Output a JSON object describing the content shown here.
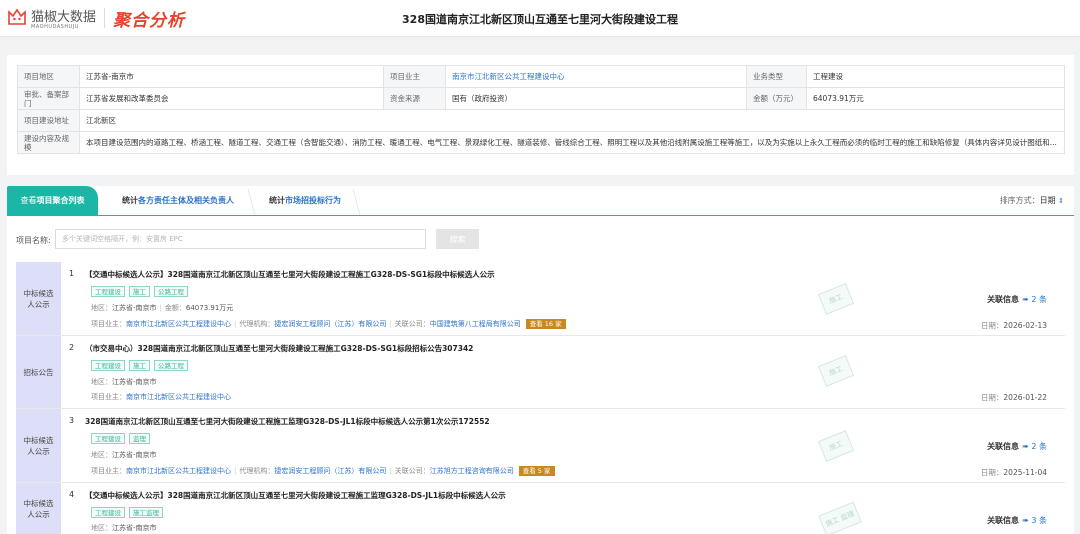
{
  "header": {
    "logo_text": "猫椒大数据",
    "logo_sub": "MAOHUDASHUJU",
    "brand": "聚合分析",
    "title": "328国道南京江北新区顶山互通至七里河大街段建设工程"
  },
  "info": {
    "location_label": "项目地区",
    "location": "江苏省-南京市",
    "owner_label": "项目业主",
    "owner": "南京市江北新区公共工程建设中心",
    "biz_type_label": "业务类型",
    "biz_type": "工程建设",
    "approval_label": "审批、备案部门",
    "approval": "江苏省发展和改革委员会",
    "fund_label": "资金来源",
    "fund": "国有（政府投资）",
    "amount_label": "金额（万元）",
    "amount": "64073.91万元",
    "address_label": "项目建设地址",
    "address": "江北新区",
    "scope_label": "建设内容及规模",
    "scope": "本项目建设范围内的道路工程、桥涵工程、隧道工程、交通工程（含智能交通）、消防工程、暖通工程、电气工程、景观绿化工程、隧道装修、管线综合工程、照明工程以及其他沿线附属设施工程等施工，以及为实施以上永久工程而必须的临时工程的施工和缺陷修复（具体内容详见设计图纸和..."
  },
  "tabs": [
    {
      "pre": "查看",
      "label": "项目聚合列表"
    },
    {
      "pre": "统计",
      "label": "各方责任主体及相关负责人"
    },
    {
      "pre": "统计",
      "label": "市场招投标行为"
    }
  ],
  "sort": {
    "label": "排序方式：",
    "value": "日期"
  },
  "search": {
    "label": "项目名称:",
    "placeholder": "多个关键词空格隔开，例：安置房 EPC",
    "button": "搜索"
  },
  "rows": [
    {
      "tag": "中标候选人公示",
      "num": "1",
      "title": "【交通中标候选人公示】328国道南京江北新区顶山互通至七里河大街段建设工程施工G328-DS-SG1标段中标候选人公示",
      "chips": [
        "工程建设",
        "施工",
        "公路工程"
      ],
      "region_label": "地区：",
      "region": "江苏省-南京市",
      "amount_label": "金额：",
      "amount": "64073.91万元",
      "owner_label": "项目业主：",
      "owner": "南京市江北新区公共工程建设中心",
      "agent_label": "代理机构：",
      "agent": "捷宏润安工程顾问（江苏）有限公司",
      "company_label": "关联公司：",
      "company": "中国建筑第八工程局有限公司",
      "badge": "查看 16 家",
      "stamp": "施工",
      "rel_label": "关联信息",
      "rel_count": "2 条",
      "date_label": "日期：",
      "date": "2026-02-13"
    },
    {
      "tag": "招标公告",
      "num": "2",
      "title": "（市交易中心）328国道南京江北新区顶山互通至七里河大街段建设工程施工G328-DS-SG1标段招标公告307342",
      "chips": [
        "工程建设",
        "施工",
        "公路工程"
      ],
      "region_label": "地区：",
      "region": "江苏省-南京市",
      "owner_label": "项目业主：",
      "owner": "南京市江北新区公共工程建设中心",
      "stamp": "施工",
      "date_label": "日期：",
      "date": "2026-01-22"
    },
    {
      "tag": "中标候选人公示",
      "num": "3",
      "title": "328国道南京江北新区顶山互通至七里河大街段建设工程施工监理G328-DS-JL1标段中标候选人公示第1次公示172552",
      "chips": [
        "工程建设",
        "监理"
      ],
      "region_label": "地区：",
      "region": "江苏省-南京市",
      "owner_label": "项目业主：",
      "owner": "南京市江北新区公共工程建设中心",
      "agent_label": "代理机构：",
      "agent": "捷宏润安工程顾问（江苏）有限公司",
      "company_label": "关联公司：",
      "company": "江苏旭方工程咨询有限公司",
      "badge": "查看 5 家",
      "stamp": "施工",
      "rel_label": "关联信息",
      "rel_count": "2 条",
      "date_label": "日期：",
      "date": "2025-11-04"
    },
    {
      "tag": "中标候选人公示",
      "num": "4",
      "title": "【交通中标候选人公示】328国道南京江北新区顶山互通至七里河大街段建设工程施工监理G328-DS-JL1标段中标候选人公示",
      "chips": [
        "工程建设",
        "施工监理"
      ],
      "region_label": "地区：",
      "region": "江苏省-南京市",
      "stamp": "施工 监理",
      "rel_label": "关联信息",
      "rel_count": "3 条"
    }
  ]
}
